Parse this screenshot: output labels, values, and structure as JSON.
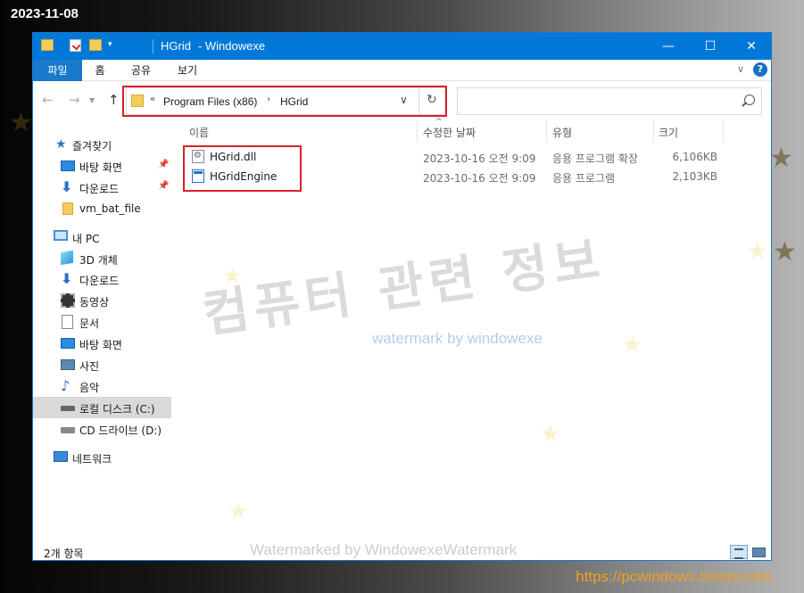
{
  "date_stamp": "2023-11-08",
  "site_url": "https://pcwindows.tistory.com",
  "window": {
    "title_primary": "HGrid",
    "title_secondary": "- Windowexe",
    "minimize": "—",
    "maximize": "☐",
    "close": "✕"
  },
  "ribbon": {
    "tabs": [
      "파일",
      "홈",
      "공유",
      "보기"
    ],
    "help": "?",
    "collapse": "∨"
  },
  "nav": {
    "back": "←",
    "forward": "→",
    "recent": "▼",
    "up": "↑",
    "address_prefix": "«",
    "breadcrumb": [
      "Program Files (x86)",
      "HGrid"
    ],
    "crumb_sep": "›",
    "dropdown": "∨",
    "refresh": "↻",
    "search_placeholder": ""
  },
  "sidebar": {
    "items": [
      {
        "label": "즐겨찾기",
        "icon": "star-icon"
      },
      {
        "label": "바탕 화면",
        "icon": "desktop-icon",
        "pinned": true
      },
      {
        "label": "다운로드",
        "icon": "download-icon",
        "pinned": true
      },
      {
        "label": "vm_bat_file",
        "icon": "folder-icon"
      },
      {
        "label": "내 PC",
        "icon": "pc-icon"
      },
      {
        "label": "3D 개체",
        "icon": "3d-objects-icon"
      },
      {
        "label": "다운로드",
        "icon": "download-icon"
      },
      {
        "label": "동영상",
        "icon": "video-icon"
      },
      {
        "label": "문서",
        "icon": "document-icon"
      },
      {
        "label": "바탕 화면",
        "icon": "desktop-icon"
      },
      {
        "label": "사진",
        "icon": "picture-icon"
      },
      {
        "label": "음악",
        "icon": "music-icon"
      },
      {
        "label": "로컬 디스크 (C:)",
        "icon": "drive-icon",
        "selected": true
      },
      {
        "label": "CD 드라이브 (D:)",
        "icon": "cd-drive-icon"
      },
      {
        "label": "네트워크",
        "icon": "network-icon"
      }
    ],
    "pin_glyph": "📌"
  },
  "columns": {
    "name": "이름",
    "date": "수정한 날짜",
    "type": "유형",
    "size": "크기",
    "sort_caret": "^"
  },
  "files": [
    {
      "name": "HGrid.dll",
      "date": "2023-10-16 오전 9:09",
      "type": "응용 프로그램 확장",
      "size": "6,106KB",
      "icon": "dll-file-icon"
    },
    {
      "name": "HGridEngine",
      "date": "2023-10-16 오전 9:09",
      "type": "응용 프로그램",
      "size": "2,103KB",
      "icon": "exe-file-icon"
    }
  ],
  "status": {
    "count": "2개 항목"
  },
  "watermarks": {
    "korean": "컴퓨터 관련 정보",
    "english": "watermark by windowexe",
    "bottom": "Watermarked by WindowexeWatermark",
    "star_glyph": "★"
  }
}
